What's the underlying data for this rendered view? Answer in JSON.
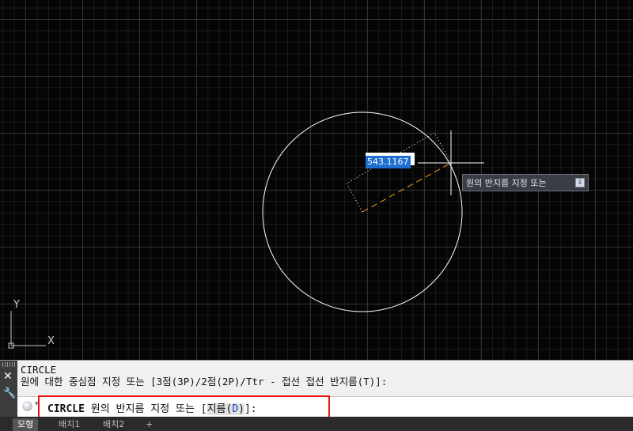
{
  "canvas": {
    "circle_color": "#ffffff",
    "radius_line_color": "#f0a020",
    "ucs": {
      "x_label": "X",
      "y_label": "Y"
    }
  },
  "dynamic_input": {
    "value": "543.1167"
  },
  "dynamic_prompt": {
    "text": "원의 반지름 지정 또는",
    "options_icon": "down-arrow-icon"
  },
  "command_window": {
    "history": [
      "CIRCLE",
      "원에 대한 중심점 지정 또는 [3점(3P)/2점(2P)/Ttr - 접선 접선 반지름(T)]:"
    ],
    "prompt": {
      "command": "CIRCLE",
      "text": " 원의 반지름 지정 또는 [",
      "option_prefix": "지름(",
      "option_key": "D",
      "option_suffix": ")",
      "end": "]:"
    }
  },
  "layout_tabs": [
    {
      "label": "모형",
      "active": true
    },
    {
      "label": "배치1",
      "active": false
    },
    {
      "label": "배치2",
      "active": false
    },
    {
      "label": "+",
      "active": false
    }
  ],
  "accent_colors": {
    "selection": "#1f6fd1",
    "highlight_box": "#ee1111"
  }
}
